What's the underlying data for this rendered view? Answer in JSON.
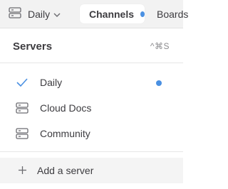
{
  "topbar": {
    "current_server": "Daily",
    "server_icon": "server-icon",
    "chevron_icon": "chevron-down-icon",
    "tabs": [
      {
        "label": "Channels",
        "active": true,
        "has_unread": true
      },
      {
        "label": "Boards",
        "active": false
      }
    ]
  },
  "dropdown": {
    "title": "Servers",
    "shortcut": "^⌘S",
    "servers": [
      {
        "name": "Daily",
        "icon": "check-icon",
        "selected": true,
        "has_unread": true
      },
      {
        "name": "Cloud Docs",
        "icon": "server-icon",
        "selected": false,
        "has_unread": false
      },
      {
        "name": "Community",
        "icon": "server-icon",
        "selected": false,
        "has_unread": false
      }
    ],
    "add_server": {
      "label": "Add a server",
      "icon": "plus-icon"
    }
  },
  "colors": {
    "accent": "#4a90e2",
    "unread_dot": "#4a90e2",
    "topbar_bg": "#f2f2f2",
    "text": "#3d3c40",
    "muted": "#8b8b8e",
    "hover_bg": "#f4f4f4"
  }
}
